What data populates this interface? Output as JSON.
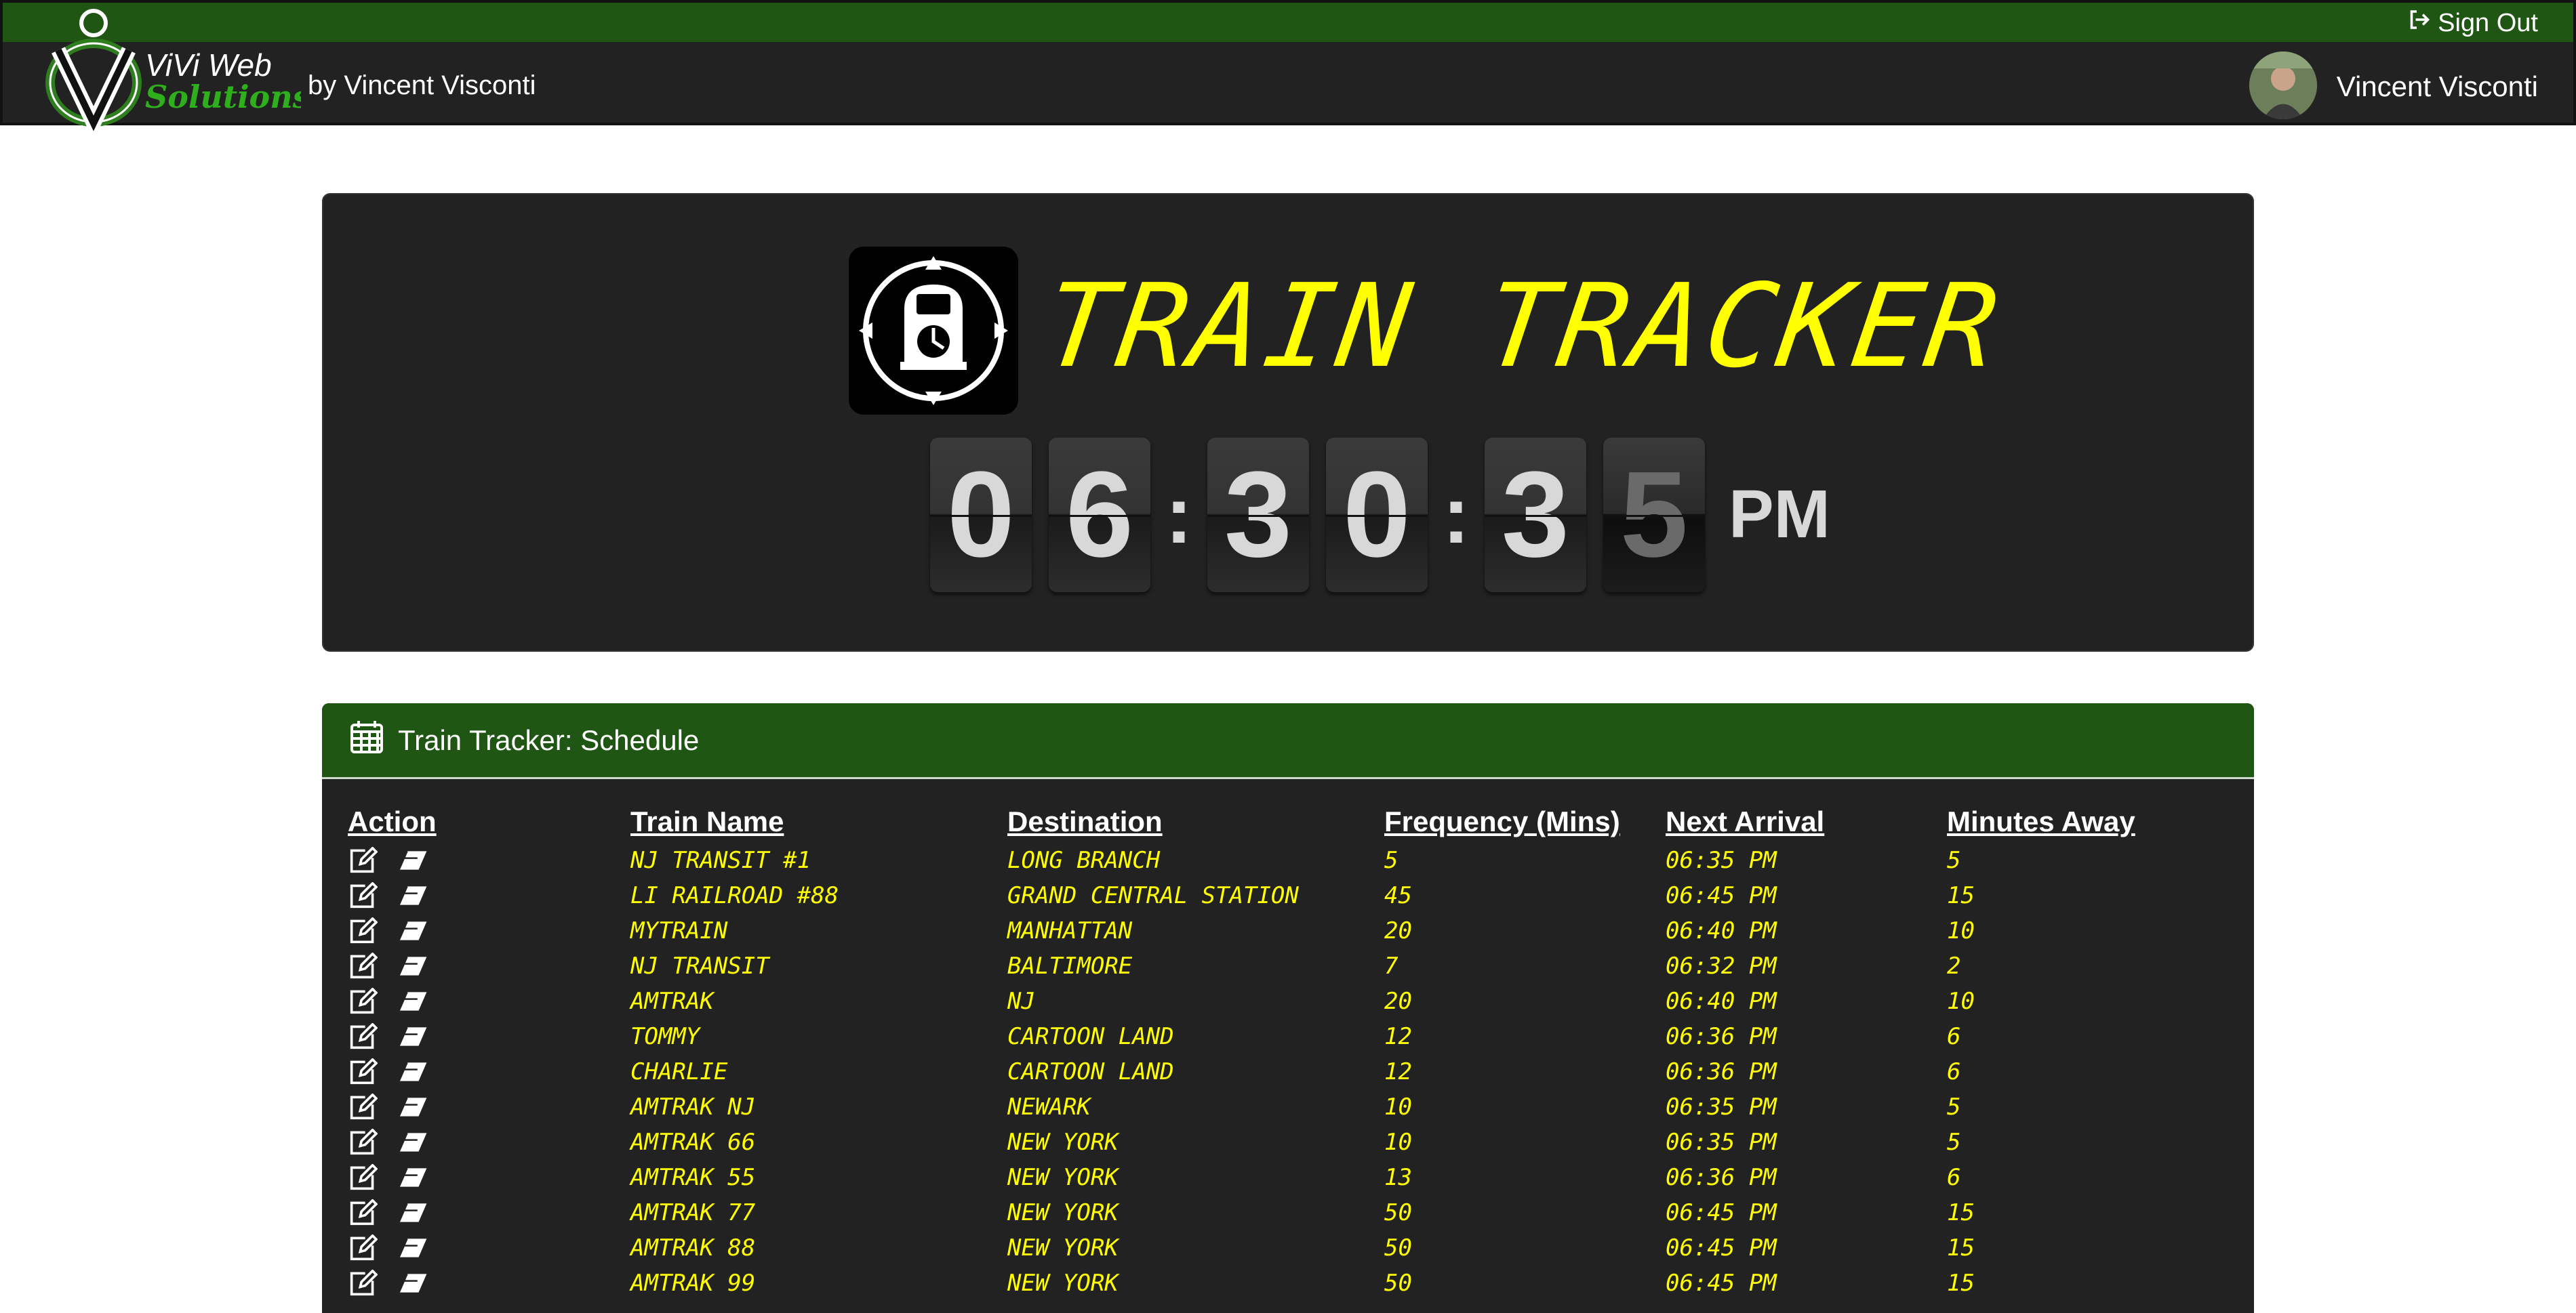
{
  "nav": {
    "sign_out_label": "Sign Out",
    "logo_text_top": "ViVi Web",
    "logo_text_bottom": "Solutions",
    "byline": "by Vincent Visconti",
    "username": "Vincent Visconti"
  },
  "hero": {
    "title": "TRAIN TRACKER",
    "clock_digits": [
      "0",
      "6",
      "3",
      "0",
      "3",
      "5"
    ],
    "ampm": "PM"
  },
  "schedule": {
    "title": "Train Tracker: Schedule",
    "columns": [
      "Action",
      "Train Name",
      "Destination",
      "Frequency (Mins)",
      "Next Arrival",
      "Minutes Away"
    ],
    "rows": [
      [
        "NJ Transit #1",
        "Long Branch",
        "5",
        "06:35 PM",
        "5"
      ],
      [
        "LI Railroad #88",
        "Grand Central Station",
        "45",
        "06:45 PM",
        "15"
      ],
      [
        "MyTrain",
        "Manhattan",
        "20",
        "06:40 PM",
        "10"
      ],
      [
        "NJ Transit",
        "Baltimore",
        "7",
        "06:32 PM",
        "2"
      ],
      [
        "Amtrak",
        "NJ",
        "20",
        "06:40 PM",
        "10"
      ],
      [
        "Tommy",
        "Cartoon Land",
        "12",
        "06:36 PM",
        "6"
      ],
      [
        "Charlie",
        "Cartoon Land",
        "12",
        "06:36 PM",
        "6"
      ],
      [
        "Amtrak NJ",
        "Newark",
        "10",
        "06:35 PM",
        "5"
      ],
      [
        "Amtrak 66",
        "New York",
        "10",
        "06:35 PM",
        "5"
      ],
      [
        "Amtrak 55",
        "New York",
        "13",
        "06:36 PM",
        "6"
      ],
      [
        "Amtrak 77",
        "New York",
        "50",
        "06:45 PM",
        "15"
      ],
      [
        "Amtrak 88",
        "New York",
        "50",
        "06:45 PM",
        "15"
      ],
      [
        "Amtrak 99",
        "New York",
        "50",
        "06:45 PM",
        "15"
      ]
    ]
  },
  "colors": {
    "brand_green": "#1f5613",
    "panel": "#222222",
    "accent_yellow": "#ffff00"
  }
}
